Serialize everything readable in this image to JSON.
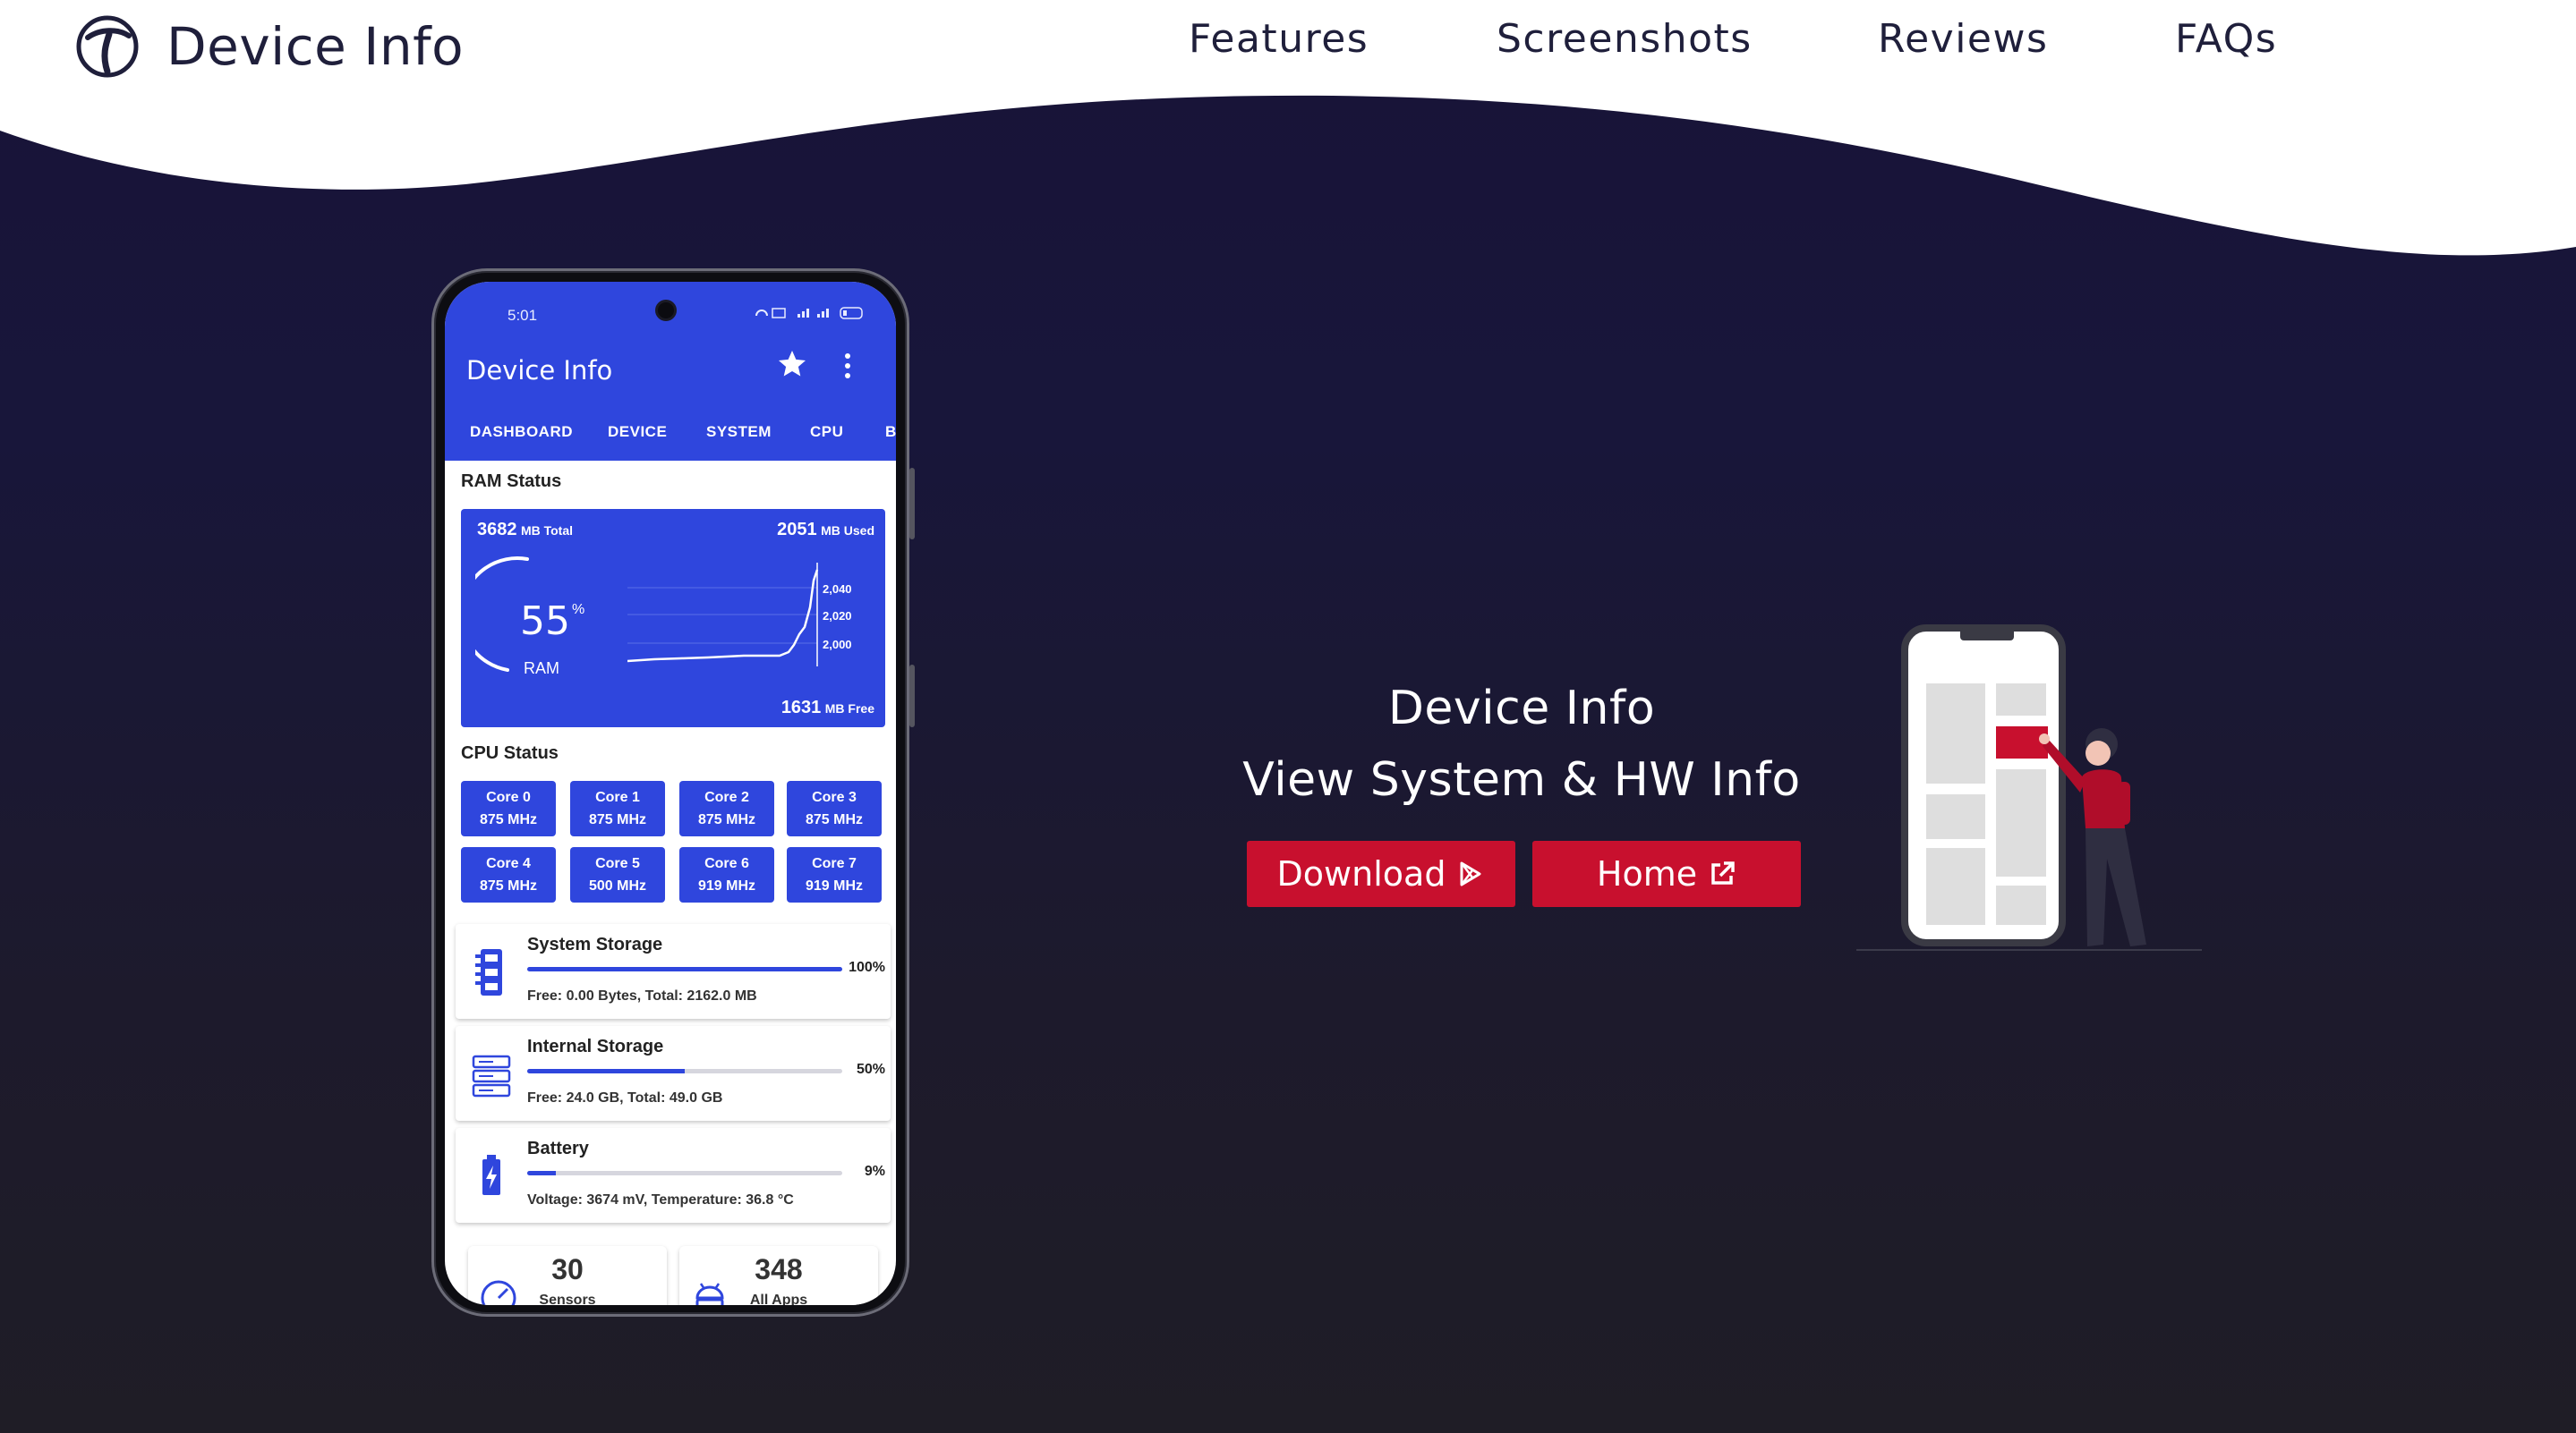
{
  "header": {
    "brand_name": "Device Info",
    "nav": [
      "Features",
      "Screenshots",
      "Reviews",
      "FAQs"
    ]
  },
  "hero": {
    "title_line1": "Device Info",
    "title_line2": "View System & HW Info",
    "download_label": "Download",
    "home_label": "Home"
  },
  "phone": {
    "status_time": "5:01",
    "app_title": "Device Info",
    "tabs": [
      "DASHBOARD",
      "DEVICE",
      "SYSTEM",
      "CPU",
      "B"
    ],
    "ram_section_label": "RAM Status",
    "ram": {
      "total_value": "3682",
      "total_unit": "MB Total",
      "used_value": "2051",
      "used_unit": "MB Used",
      "free_value": "1631",
      "free_unit": "MB Free",
      "percent": "55",
      "percent_symbol": "%",
      "label": "RAM",
      "chart_ticks": [
        "2,040",
        "2,020",
        "2,000"
      ]
    },
    "cpu_section_label": "CPU Status",
    "cores": [
      {
        "name": "Core 0",
        "freq": "875 MHz"
      },
      {
        "name": "Core 1",
        "freq": "875 MHz"
      },
      {
        "name": "Core 2",
        "freq": "875 MHz"
      },
      {
        "name": "Core 3",
        "freq": "875 MHz"
      },
      {
        "name": "Core 4",
        "freq": "875 MHz"
      },
      {
        "name": "Core 5",
        "freq": "500 MHz"
      },
      {
        "name": "Core 6",
        "freq": "919 MHz"
      },
      {
        "name": "Core 7",
        "freq": "919 MHz"
      }
    ],
    "system_storage": {
      "title": "System Storage",
      "percent_label": "100%",
      "fill": 1.0,
      "detail": "Free: 0.00 Bytes, Total: 2162.0 MB"
    },
    "internal_storage": {
      "title": "Internal Storage",
      "percent_label": "50%",
      "fill": 0.5,
      "detail": "Free: 24.0 GB, Total: 49.0 GB"
    },
    "battery": {
      "title": "Battery",
      "percent_label": "9%",
      "fill": 0.09,
      "detail": "Voltage: 3674 mV, Temperature: 36.8 °C"
    },
    "sensors": {
      "count": "30",
      "label": "Sensors"
    },
    "apps": {
      "count": "348",
      "label": "All Apps"
    }
  },
  "colors": {
    "accent_blue": "#2f46dd",
    "button_red": "#c8102e",
    "background_navy": "#181338"
  }
}
